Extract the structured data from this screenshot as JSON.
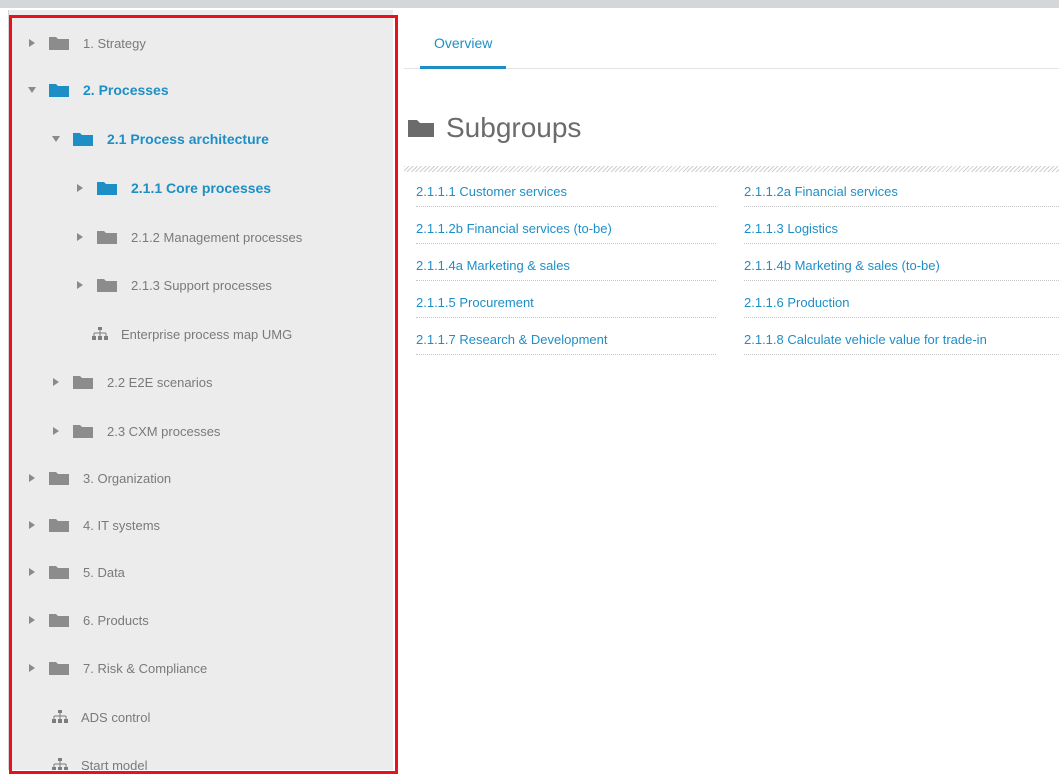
{
  "sidebar": {
    "items": [
      {
        "label": "1. Strategy"
      },
      {
        "label": "2. Processes"
      },
      {
        "label": "2.1 Process architecture"
      },
      {
        "label": "2.1.1 Core processes"
      },
      {
        "label": "2.1.2 Management processes"
      },
      {
        "label": "2.1.3 Support processes"
      },
      {
        "label": "Enterprise process map UMG"
      },
      {
        "label": "2.2 E2E scenarios"
      },
      {
        "label": "2.3 CXM processes"
      },
      {
        "label": "3. Organization"
      },
      {
        "label": "4. IT systems"
      },
      {
        "label": "5. Data"
      },
      {
        "label": "6. Products"
      },
      {
        "label": "7. Risk & Compliance"
      },
      {
        "label": "ADS control"
      },
      {
        "label": "Start model"
      }
    ]
  },
  "tabs": [
    {
      "label": "Overview"
    }
  ],
  "main": {
    "heading": "Subgroups",
    "subgroups": [
      [
        "2.1.1.1 Customer services",
        "2.1.1.2a Financial services"
      ],
      [
        "2.1.1.2b Financial services (to-be)",
        "2.1.1.3 Logistics"
      ],
      [
        "2.1.1.4a Marketing & sales",
        "2.1.1.4b Marketing & sales (to-be)"
      ],
      [
        "2.1.1.5 Procurement",
        "2.1.1.6 Production"
      ],
      [
        "2.1.1.7 Research & Development",
        "2.1.1.8 Calculate vehicle value for trade-in"
      ]
    ]
  },
  "colors": {
    "accent": "#1e8fc6",
    "sidebar_bg": "#ececec",
    "muted_text": "#7a7a7a",
    "highlight": "#e8121c"
  },
  "icons": {
    "expand": "caret-right-icon",
    "collapse": "caret-down-icon",
    "group": "folder-icon",
    "model": "hierarchy-icon"
  }
}
